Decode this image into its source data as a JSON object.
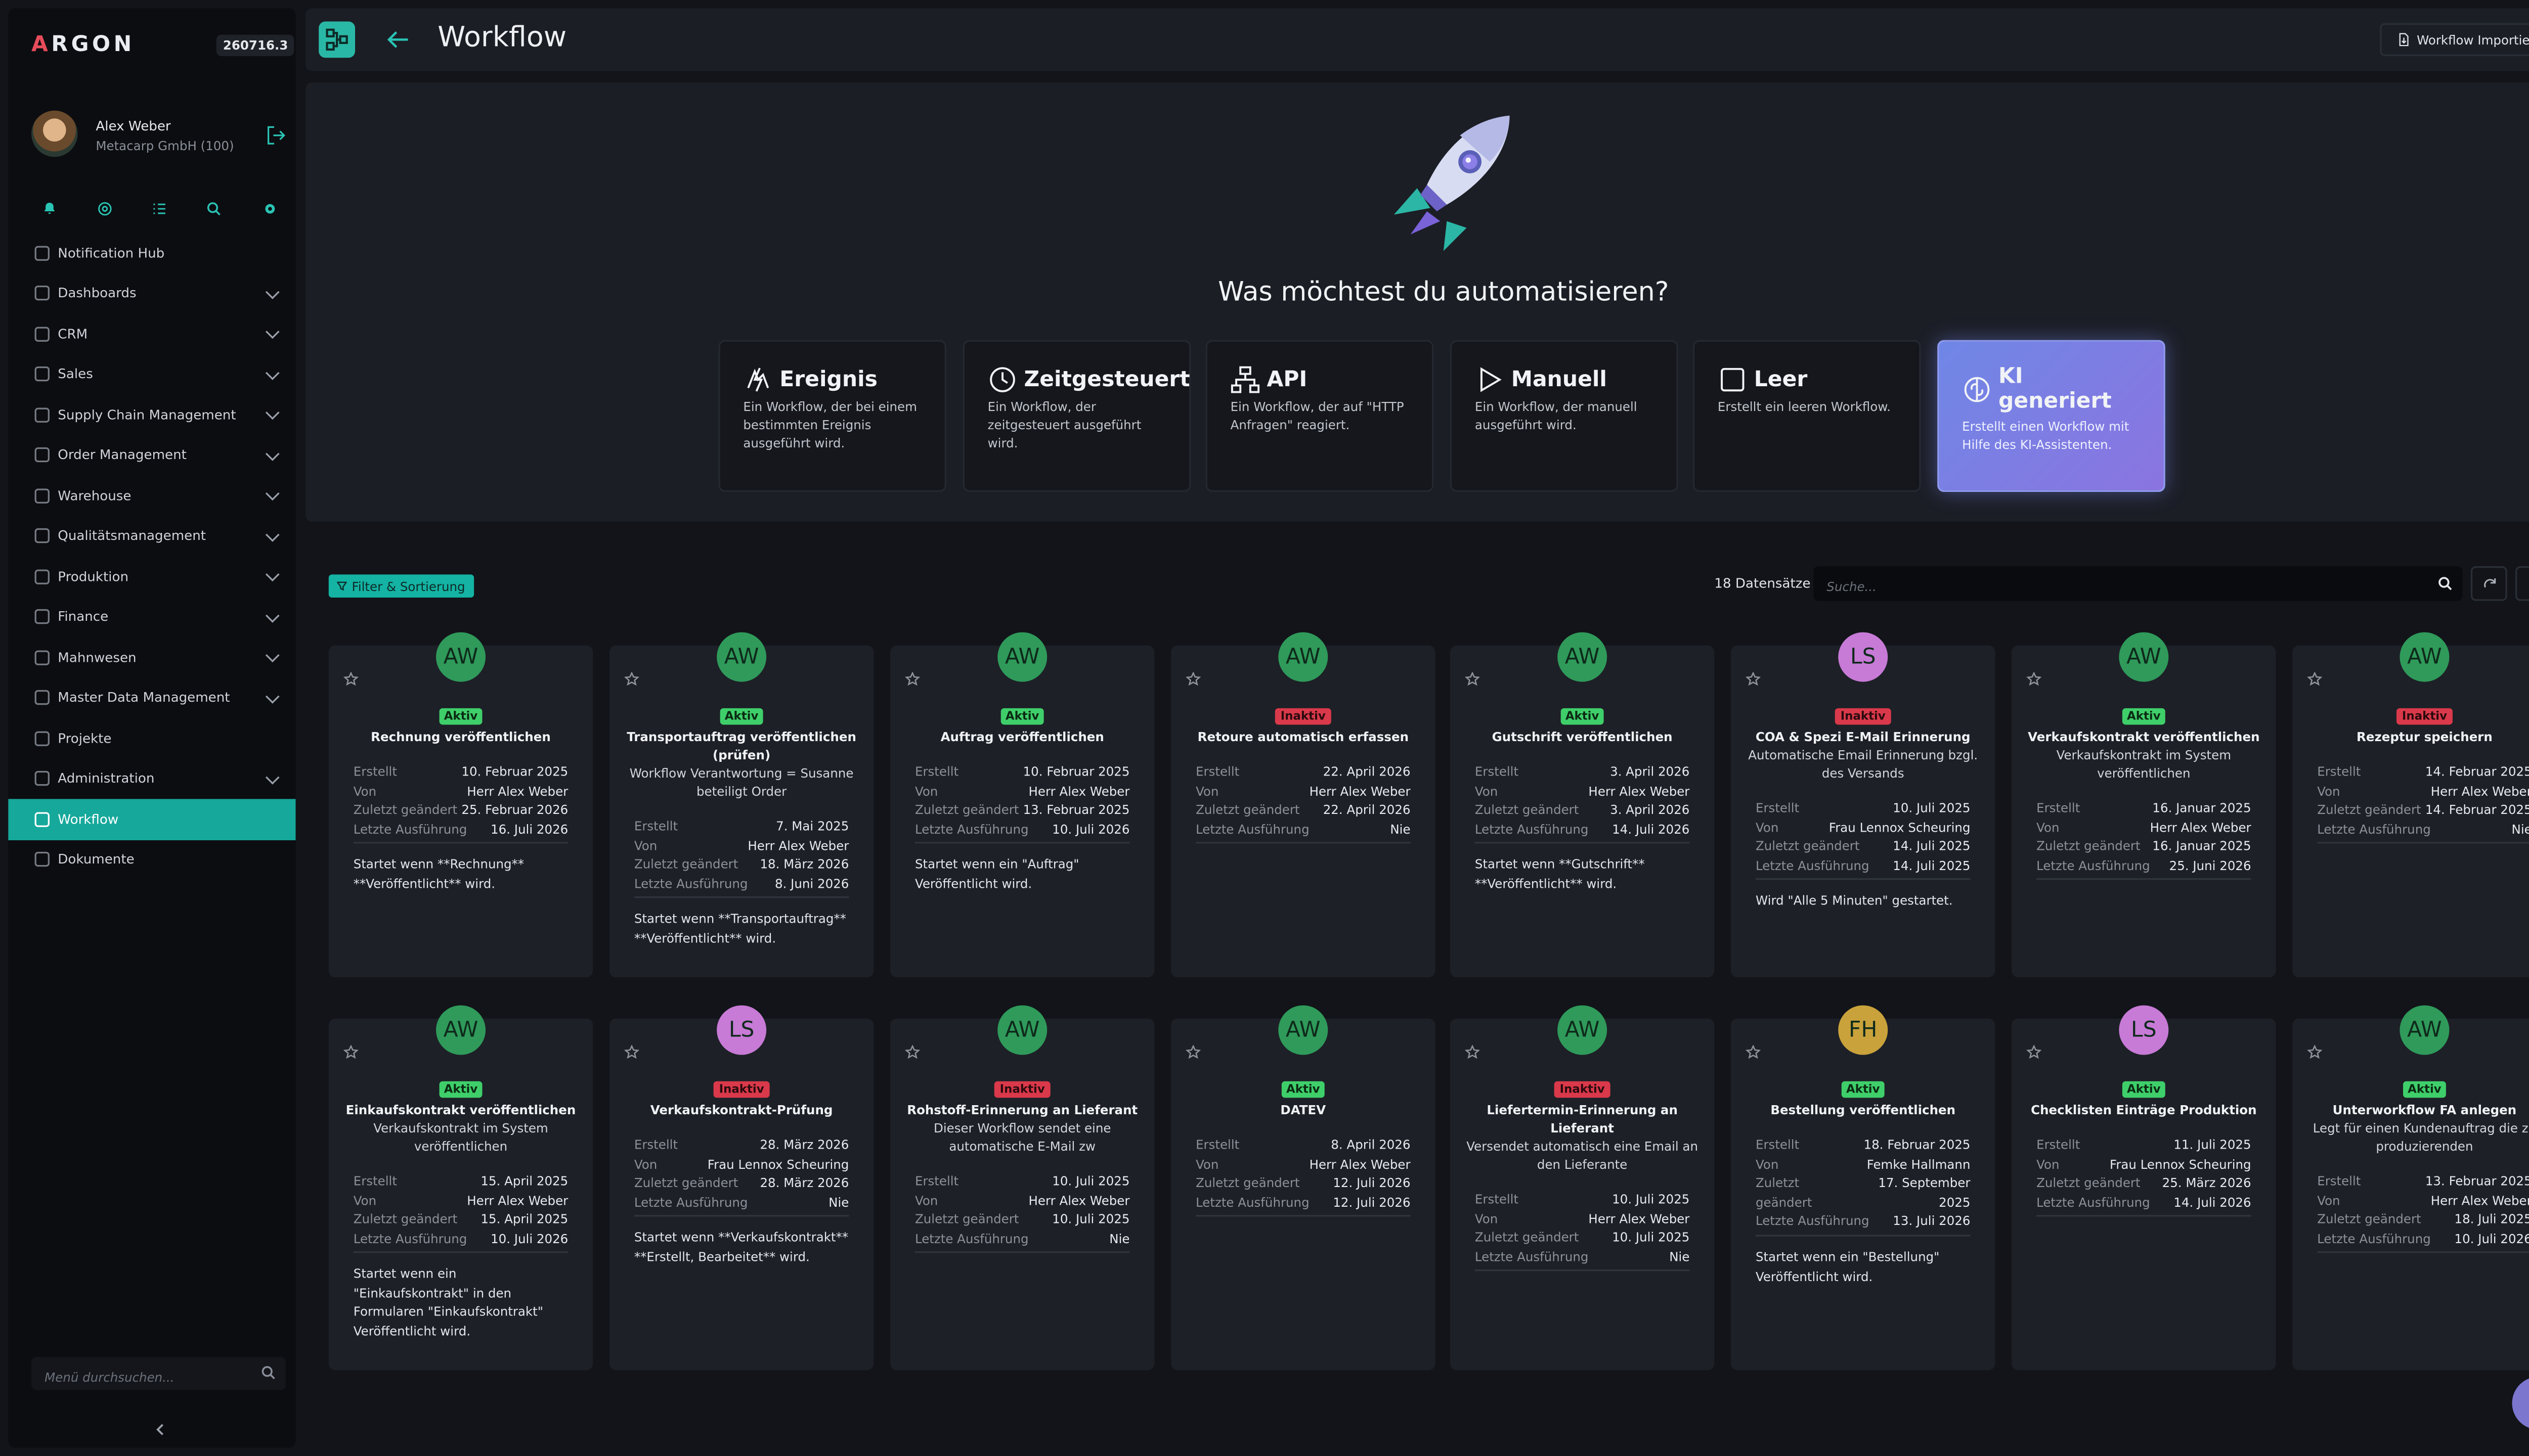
{
  "app": {
    "brand": "ARGON",
    "brand_first": "A",
    "brand_rest": "RGON",
    "version": "260716.3"
  },
  "user": {
    "name": "Alex Weber",
    "company": "Metacarp GmbH (100)"
  },
  "quick_icons": [
    "bell-icon",
    "globe-icon",
    "list-icon",
    "search-icon",
    "gear-icon"
  ],
  "nav": [
    {
      "label": "Notification Hub",
      "chevron": false,
      "active": false
    },
    {
      "label": "Dashboards",
      "chevron": true,
      "active": false
    },
    {
      "label": "CRM",
      "chevron": true,
      "active": false
    },
    {
      "label": "Sales",
      "chevron": true,
      "active": false
    },
    {
      "label": "Supply Chain Management",
      "chevron": true,
      "active": false
    },
    {
      "label": "Order Management",
      "chevron": true,
      "active": false
    },
    {
      "label": "Warehouse",
      "chevron": true,
      "active": false
    },
    {
      "label": "Qualitätsmanagement",
      "chevron": true,
      "active": false
    },
    {
      "label": "Produktion",
      "chevron": true,
      "active": false
    },
    {
      "label": "Finance",
      "chevron": true,
      "active": false
    },
    {
      "label": "Mahnwesen",
      "chevron": true,
      "active": false
    },
    {
      "label": "Master Data Management",
      "chevron": true,
      "active": false
    },
    {
      "label": "Projekte",
      "chevron": false,
      "active": false
    },
    {
      "label": "Administration",
      "chevron": true,
      "active": false
    },
    {
      "label": "Workflow",
      "chevron": false,
      "active": true
    },
    {
      "label": "Dokumente",
      "chevron": false,
      "active": false
    }
  ],
  "menu_search": {
    "placeholder": "Menü durchsuchen..."
  },
  "header": {
    "title": "Workflow",
    "import_label": "Workflow Importieren"
  },
  "hero": {
    "title": "Was möchtest du automatisieren?"
  },
  "types": [
    {
      "title": "Ereignis",
      "desc": "Ein Workflow, der bei einem bestimmten Ereignis ausgeführt wird.",
      "icon": "event-icon",
      "highlight": false
    },
    {
      "title": "Zeitgesteuert",
      "desc": "Ein Workflow, der zeitgesteuert ausgeführt wird.",
      "icon": "clock-icon",
      "highlight": false
    },
    {
      "title": "API",
      "desc": "Ein Workflow, der auf \"HTTP Anfragen\" reagiert.",
      "icon": "api-icon",
      "highlight": false
    },
    {
      "title": "Manuell",
      "desc": "Ein Workflow, der manuell ausgeführt wird.",
      "icon": "play-icon",
      "highlight": false
    },
    {
      "title": "Leer",
      "desc": "Erstellt ein leeren Workflow.",
      "icon": "square-icon",
      "highlight": false
    },
    {
      "title": "KI generiert",
      "desc": "Erstellt einen Workflow mit Hilfe des KI-Assistenten.",
      "icon": "ai-icon",
      "highlight": true
    }
  ],
  "list": {
    "filter_label": "Filter & Sortierung",
    "count_label": "18 Datensätze",
    "search_placeholder": "Suche..."
  },
  "meta_labels": {
    "created": "Erstellt",
    "by": "Von",
    "changed": "Zuletzt geändert",
    "last_run": "Letzte Ausführung"
  },
  "colors": {
    "accent": "#16a89b",
    "active": "#3fcf6a",
    "inactive": "#d9394a",
    "ai_card": "#7b80e4"
  },
  "cards": [
    {
      "initials": "AW",
      "avatar_color": "#2f9a5a",
      "status": "Aktiv",
      "active": true,
      "title": "Rechnung veröffentlichen",
      "desc": "",
      "created": "10. Februar 2025",
      "by": "Herr Alex Weber",
      "changed": "25. Februar 2026",
      "last_run": "16. Juli 2026",
      "start": "Startet wenn **Rechnung** **Veröffentlicht** wird."
    },
    {
      "initials": "AW",
      "avatar_color": "#2f9a5a",
      "status": "Aktiv",
      "active": true,
      "title": "Transportauftrag veröffentlichen (prüfen)",
      "desc": "Workflow Verantwortung = Susanne beteiligt Order",
      "created": "7. Mai 2025",
      "by": "Herr Alex Weber",
      "changed": "18. März 2026",
      "last_run": "8. Juni 2026",
      "start": "Startet wenn **Transportauftrag** **Veröffentlicht** wird."
    },
    {
      "initials": "AW",
      "avatar_color": "#2f9a5a",
      "status": "Aktiv",
      "active": true,
      "title": "Auftrag veröffentlichen",
      "desc": "",
      "created": "10. Februar 2025",
      "by": "Herr Alex Weber",
      "changed": "13. Februar 2025",
      "last_run": "10. Juli 2026",
      "start": "Startet wenn ein \"Auftrag\" Veröffentlicht wird."
    },
    {
      "initials": "AW",
      "avatar_color": "#2f9a5a",
      "status": "Inaktiv",
      "active": false,
      "title": "Retoure automatisch erfassen",
      "desc": "",
      "created": "22. April 2026",
      "by": "Herr Alex Weber",
      "changed": "22. April 2026",
      "last_run": "Nie",
      "start": ""
    },
    {
      "initials": "AW",
      "avatar_color": "#2f9a5a",
      "status": "Aktiv",
      "active": true,
      "title": "Gutschrift veröffentlichen",
      "desc": "",
      "created": "3. April 2026",
      "by": "Herr Alex Weber",
      "changed": "3. April 2026",
      "last_run": "14. Juli 2026",
      "start": "Startet wenn **Gutschrift** **Veröffentlicht** wird."
    },
    {
      "initials": "LS",
      "avatar_color": "#c77ad6",
      "status": "Inaktiv",
      "active": false,
      "title": "COA & Spezi E-Mail Erinnerung",
      "desc": "Automatische Email Erinnerung bzgl. des Versands",
      "created": "10. Juli 2025",
      "by": "Frau Lennox Scheuring",
      "changed": "14. Juli 2025",
      "last_run": "14. Juli 2025",
      "start": "Wird \"Alle 5 Minuten\" gestartet."
    },
    {
      "initials": "AW",
      "avatar_color": "#2f9a5a",
      "status": "Aktiv",
      "active": true,
      "title": "Verkaufskontrakt veröffentlichen",
      "desc": "Verkaufskontrakt im System veröffentlichen",
      "created": "16. Januar 2025",
      "by": "Herr Alex Weber",
      "changed": "16. Januar 2025",
      "last_run": "25. Juni 2026",
      "start": ""
    },
    {
      "initials": "AW",
      "avatar_color": "#2f9a5a",
      "status": "Inaktiv",
      "active": false,
      "title": "Rezeptur speichern",
      "desc": "",
      "created": "14. Februar 2025",
      "by": "Herr Alex Weber",
      "changed": "14. Februar 2025",
      "last_run": "Nie",
      "start": ""
    },
    {
      "initials": "AW",
      "avatar_color": "#2f9a5a",
      "status": "Aktiv",
      "active": true,
      "title": "Einkaufskontrakt veröffentlichen",
      "desc": "Verkaufskontrakt im System veröffentlichen",
      "created": "15. April 2025",
      "by": "Herr Alex Weber",
      "changed": "15. April 2025",
      "last_run": "10. Juli 2026",
      "start": "Startet wenn ein \"Einkaufskontrakt\" in den Formularen \"Einkaufskontrakt\" Veröffentlicht wird."
    },
    {
      "initials": "LS",
      "avatar_color": "#c77ad6",
      "status": "Inaktiv",
      "active": false,
      "title": "Verkaufskontrakt-Prüfung",
      "desc": "",
      "created": "28. März 2026",
      "by": "Frau Lennox Scheuring",
      "changed": "28. März 2026",
      "last_run": "Nie",
      "start": "Startet wenn **Verkaufskontrakt** **Erstellt, Bearbeitet** wird."
    },
    {
      "initials": "AW",
      "avatar_color": "#2f9a5a",
      "status": "Inaktiv",
      "active": false,
      "title": "Rohstoff-Erinnerung an Lieferant",
      "desc": "Dieser Workflow sendet eine automatische E-Mail zw",
      "created": "10. Juli 2025",
      "by": "Herr Alex Weber",
      "changed": "10. Juli 2025",
      "last_run": "Nie",
      "start": ""
    },
    {
      "initials": "AW",
      "avatar_color": "#2f9a5a",
      "status": "Aktiv",
      "active": true,
      "title": "DATEV",
      "desc": "",
      "created": "8. April 2026",
      "by": "Herr Alex Weber",
      "changed": "12. Juli 2026",
      "last_run": "12. Juli 2026",
      "start": ""
    },
    {
      "initials": "AW",
      "avatar_color": "#2f9a5a",
      "status": "Inaktiv",
      "active": false,
      "title": "Liefertermin-Erinnerung an Lieferant",
      "desc": "Versendet automatisch eine Email an den Lieferante",
      "created": "10. Juli 2025",
      "by": "Herr Alex Weber",
      "changed": "10. Juli 2025",
      "last_run": "Nie",
      "start": ""
    },
    {
      "initials": "FH",
      "avatar_color": "#c9a23b",
      "status": "Aktiv",
      "active": true,
      "title": "Bestellung veröffentlichen",
      "desc": "",
      "created": "18. Februar 2025",
      "by": "Femke Hallmann",
      "changed": "17. September 2025",
      "last_run": "13. Juli 2026",
      "start": "Startet wenn ein \"Bestellung\" Veröffentlicht wird."
    },
    {
      "initials": "LS",
      "avatar_color": "#c77ad6",
      "status": "Aktiv",
      "active": true,
      "title": "Checklisten Einträge Produktion",
      "desc": "",
      "created": "11. Juli 2025",
      "by": "Frau Lennox Scheuring",
      "changed": "25. März 2026",
      "last_run": "14. Juli 2026",
      "start": ""
    },
    {
      "initials": "AW",
      "avatar_color": "#2f9a5a",
      "status": "Aktiv",
      "active": true,
      "title": "Unterworkflow FA anlegen",
      "desc": "Legt für einen Kundenauftrag die zu produzierenden",
      "created": "13. Februar 2025",
      "by": "Herr Alex Weber",
      "changed": "18. Juli 2025",
      "last_run": "10. Juli 2026",
      "start": ""
    }
  ]
}
